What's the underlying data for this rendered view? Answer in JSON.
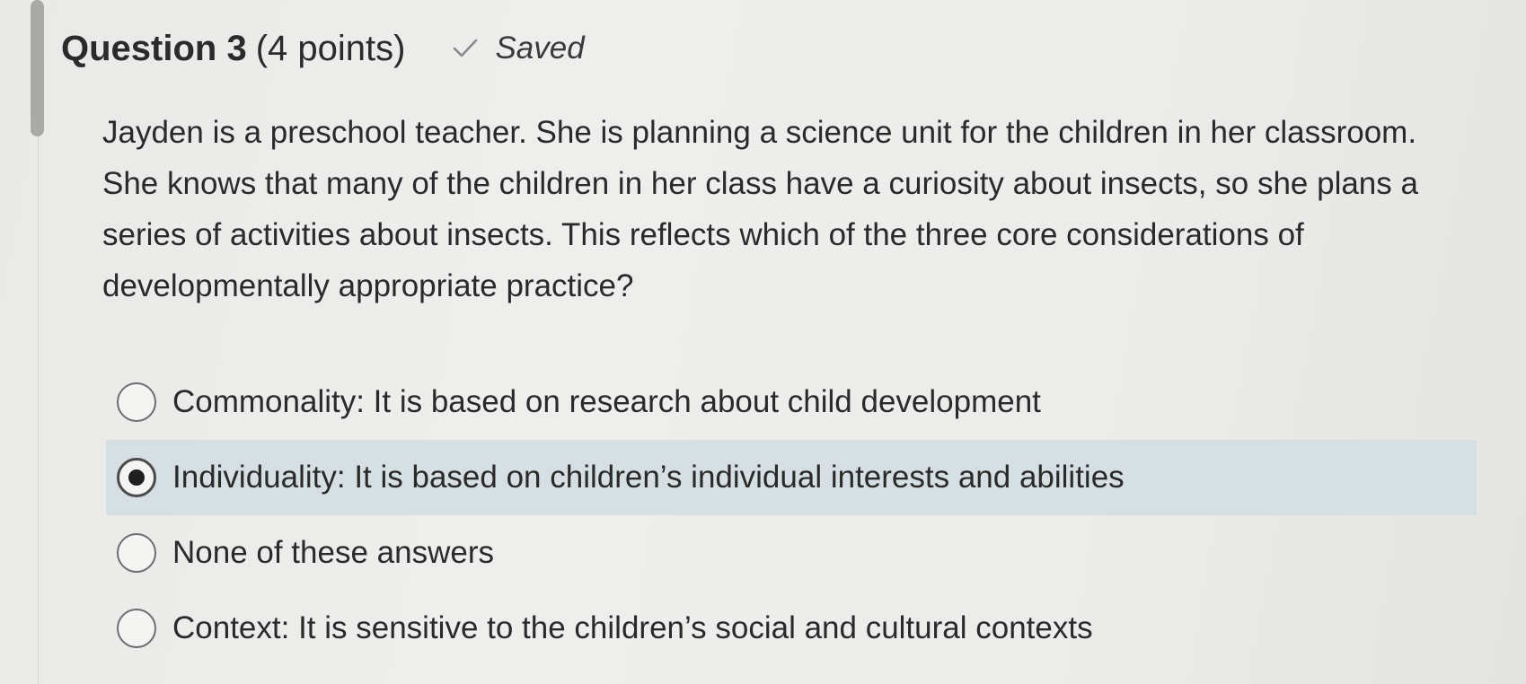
{
  "question": {
    "title": "Question 3",
    "points": "(4 points)",
    "status_icon": "check-icon",
    "status": "Saved",
    "text": "Jayden is a preschool teacher. She is planning a science unit for the children in her classroom. She knows that many of the children in her class have a curiosity about insects, so she plans a series of activities about insects. This reflects which of the three core considerations of developmentally appropriate practice?"
  },
  "options": [
    {
      "label": "Commonality:  It is based on research about child development",
      "selected": false
    },
    {
      "label": "Individuality:  It is based on children’s individual interests and abilities",
      "selected": true
    },
    {
      "label": "None of these answers",
      "selected": false
    },
    {
      "label": "Context:  It is sensitive to the children’s social and cultural contexts",
      "selected": false
    }
  ],
  "colors": {
    "selected_background": "#d6dfe3",
    "text": "#2a2a2a",
    "check": "#8a8a8a"
  }
}
